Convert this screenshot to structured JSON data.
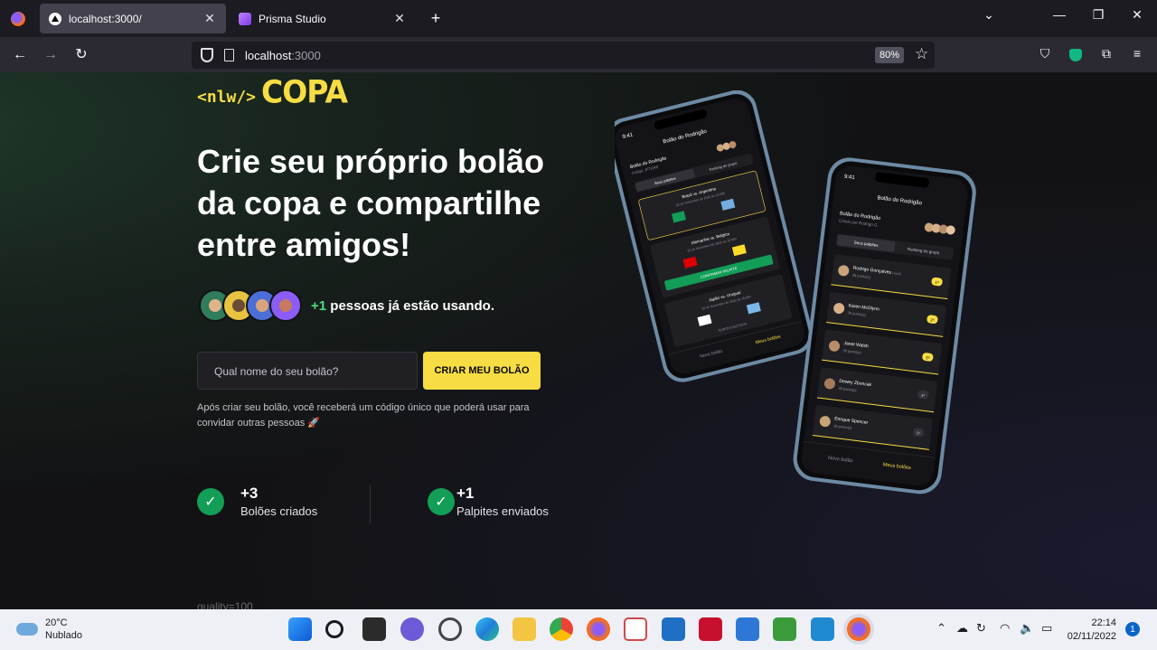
{
  "browser": {
    "tabs": [
      {
        "title": "localhost:3000/",
        "active": true
      },
      {
        "title": "Prisma Studio",
        "active": false
      }
    ],
    "url_host": "localhost",
    "url_port": ":3000",
    "zoom": "80%"
  },
  "page": {
    "logo_tag": "<nlw/>",
    "logo_word": "COPA",
    "headline": "Crie seu próprio bolão da copa e compartilhe entre amigos!",
    "social_plus": "+1",
    "social_text": " pessoas já estão usando.",
    "input_placeholder": "Qual nome do seu bolão?",
    "cta_label": "CRIAR MEU BOLÃO",
    "note": "Após criar seu bolão, você receberá um código único que poderá usar para convidar outras pessoas 🚀",
    "stats": [
      {
        "value": "+3",
        "label": "Bolões criados"
      },
      {
        "value": "+1",
        "label": "Palpites enviados"
      }
    ],
    "cutoff_text": "quality=100"
  },
  "phone_front": {
    "time": "9:41",
    "title": "Bolão do Rodrigão",
    "pool_name": "Bolão do Rodrigão",
    "pool_owner": "Criado por Rodrigo G.",
    "tabs": [
      "Seus palpites",
      "Ranking do grupo"
    ],
    "ranking": [
      {
        "name": "Rodrigo Gonçalves",
        "suffix": "(você)",
        "points": "36 ponto(s)",
        "pos": "1º"
      },
      {
        "name": "Karen McGlynn",
        "suffix": "",
        "points": "36 ponto(s)",
        "pos": "2º"
      },
      {
        "name": "Janet Walsh",
        "suffix": "",
        "points": "36 ponto(s)",
        "pos": "3º"
      },
      {
        "name": "Dewey Zboncak",
        "suffix": "",
        "points": "36 ponto(s)",
        "pos": "4º"
      },
      {
        "name": "Enrique Spencer",
        "suffix": "",
        "points": "36 ponto(s)",
        "pos": "5º"
      }
    ],
    "nav": [
      "Novo bolão",
      "Meus bolões"
    ]
  },
  "phone_back": {
    "time": "9:41",
    "title": "Bolão do Rodrigão",
    "pool_name": "Bolão do Rodrigão",
    "pool_code": "Código: JFTGRE",
    "tabs": [
      "Seus palpites",
      "Ranking do grupo"
    ],
    "games": [
      {
        "teams": "Brasil vs. Argentina",
        "date": "22 de Novembro de 2022 às 16:00h"
      },
      {
        "teams": "Alemanha vs. Bélgica",
        "date": "22 de Novembro de 2022 às 16:00h",
        "confirm": "CONFIRMAR PALPITE"
      },
      {
        "teams": "Japão vs. Uruguai",
        "date": "22 de Novembro de 2022 às 16:00h",
        "status": "TEMPO ESGOTADO"
      }
    ],
    "nav": [
      "Novo bolão",
      "Meus bolões"
    ]
  },
  "taskbar": {
    "temperature": "20°C",
    "condition": "Nublado",
    "time": "22:14",
    "date": "02/11/2022",
    "notifications": "1"
  },
  "colors": {
    "accent_yellow": "#F7DD43",
    "accent_green": "#129E57",
    "background": "#121214"
  }
}
